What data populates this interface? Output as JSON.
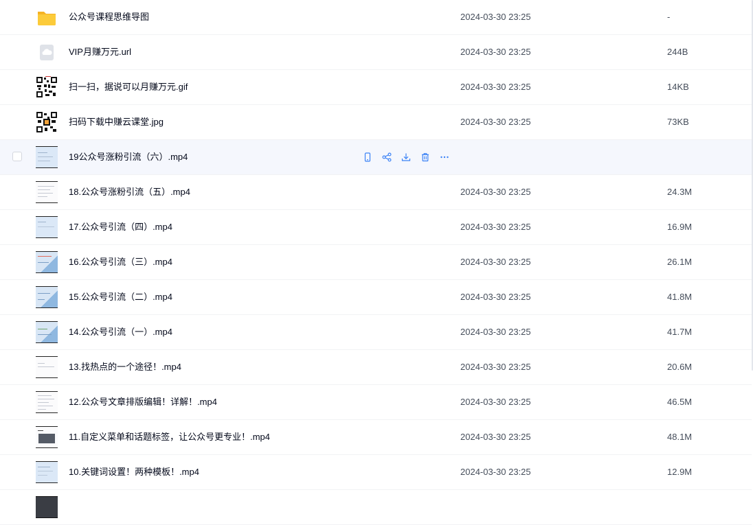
{
  "row_actions": {
    "phone_icon": "mobile-icon",
    "share_icon": "share-icon",
    "download_icon": "download-icon",
    "delete_icon": "trash-icon",
    "more_icon": "more-icon",
    "accent": "#3b82f6"
  },
  "files": [
    {
      "name": "公众号课程思维导图",
      "time": "2024-03-30 23:25",
      "size": "-",
      "thumb": "folder"
    },
    {
      "name": "VIP月赚万元.url",
      "time": "2024-03-30 23:25",
      "size": "244B",
      "thumb": "cloud"
    },
    {
      "name": "扫一扫，据说可以月赚万元.gif",
      "time": "2024-03-30 23:25",
      "size": "14KB",
      "thumb": "qr"
    },
    {
      "name": "扫码下载中赚云课堂.jpg",
      "time": "2024-03-30 23:25",
      "size": "73KB",
      "thumb": "qr"
    },
    {
      "name": "19公众号涨粉引流（六）.mp4",
      "time": "",
      "size": "",
      "thumb": "video"
    },
    {
      "name": "18.公众号涨粉引流（五）.mp4",
      "time": "2024-03-30 23:25",
      "size": "24.3M",
      "thumb": "video"
    },
    {
      "name": "17.公众号引流（四）.mp4",
      "time": "2024-03-30 23:25",
      "size": "16.9M",
      "thumb": "video"
    },
    {
      "name": "16.公众号引流（三）.mp4",
      "time": "2024-03-30 23:25",
      "size": "26.1M",
      "thumb": "video"
    },
    {
      "name": "15.公众号引流（二）.mp4",
      "time": "2024-03-30 23:25",
      "size": "41.8M",
      "thumb": "video"
    },
    {
      "name": "14.公众号引流（一）.mp4",
      "time": "2024-03-30 23:25",
      "size": "41.7M",
      "thumb": "video"
    },
    {
      "name": "13.找热点的一个途径！.mp4",
      "time": "2024-03-30 23:25",
      "size": "20.6M",
      "thumb": "video"
    },
    {
      "name": "12.公众号文章排版编辑！详解！.mp4",
      "time": "2024-03-30 23:25",
      "size": "46.5M",
      "thumb": "video"
    },
    {
      "name": "11.自定义菜单和话题标签，让公众号更专业！.mp4",
      "time": "2024-03-30 23:25",
      "size": "48.1M",
      "thumb": "video"
    },
    {
      "name": "10.关键词设置！两种模板！.mp4",
      "time": "2024-03-30 23:25",
      "size": "12.9M",
      "thumb": "video"
    }
  ]
}
